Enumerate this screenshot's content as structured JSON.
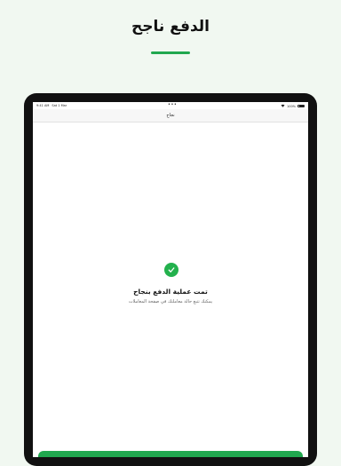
{
  "promo": {
    "title": "الدفع ناجح"
  },
  "status_bar": {
    "time": "9:41 AM",
    "date": "Sat 1 Mar",
    "battery": "100%",
    "battery_level": 1.0
  },
  "navbar": {
    "title": "نجاح"
  },
  "success": {
    "title": "تمت عملية الدفع بنجاح",
    "subtitle": "يمكنك تتبع حالة معاملتك في صفحة المعاملات"
  },
  "colors": {
    "accent": "#21a84f",
    "background": "#f1f8f1"
  },
  "icons": {
    "success": "check-circle-icon",
    "wifi": "wifi-icon",
    "battery": "battery-icon"
  }
}
